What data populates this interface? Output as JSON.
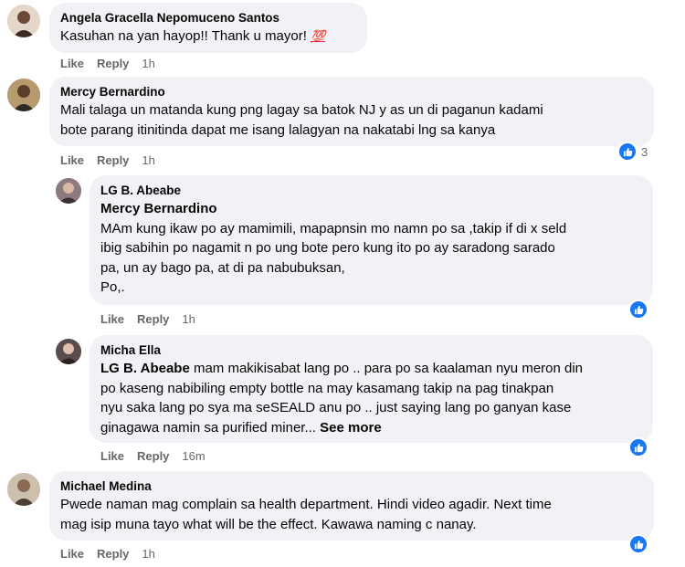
{
  "comments": [
    {
      "author": "Angela Gracella Nepomuceno Santos",
      "text": "Kasuhan na yan hayop!! Thank u mayor!",
      "emoji": "💯",
      "like": "Like",
      "reply": "Reply",
      "time": "1h"
    },
    {
      "author": "Mercy Bernardino",
      "line1": "Mali talaga un matanda kung png lagay sa batok NJ y as un di paganun kadami",
      "line2": "bote parang itinitinda dapat me isang lalagyan na nakatabi lng sa kanya",
      "like": "Like",
      "reply": "Reply",
      "time": "1h",
      "reaction_count": "3"
    },
    {
      "author": "LG B. Abeabe",
      "mention": "Mercy Bernardino",
      "line1": "MAm kung ikaw po ay mamimili, mapapnsin mo namn po sa ,takip if di x seld",
      "line2": "ibig sabihin po nagamit n po ung bote pero kung ito po ay saradong sarado",
      "line3": "pa, un ay bago pa, at di pa nabubuksan,",
      "line4": "Po,.",
      "like": "Like",
      "reply": "Reply",
      "time": "1h"
    },
    {
      "author": "Micha Ella",
      "mention": "LG B. Abeabe",
      "line1_rest": " mam makikisabat lang po .. para po sa kaalaman nyu meron din",
      "line2": "po kaseng nabibiling empty bottle na may kasamang takip na pag tinakpan",
      "line3": "nyu saka lang po sya ma seSEALD anu po .. just saying lang po ganyan kase",
      "line4": "ginagawa namin sa purified miner...",
      "see_more": "See more",
      "like": "Like",
      "reply": "Reply",
      "time": "16m"
    },
    {
      "author": "Michael Medina",
      "line1": "Pwede naman mag complain sa health department. Hindi video agadir. Next time",
      "line2": "mag isip muna tayo what will be the effect. Kawawa naming c nanay.",
      "like": "Like",
      "reply": "Reply",
      "time": "1h"
    }
  ],
  "colors": {
    "bubble": "#f0f2f5",
    "meta": "#65676b",
    "like_badge": "#1877f2"
  }
}
